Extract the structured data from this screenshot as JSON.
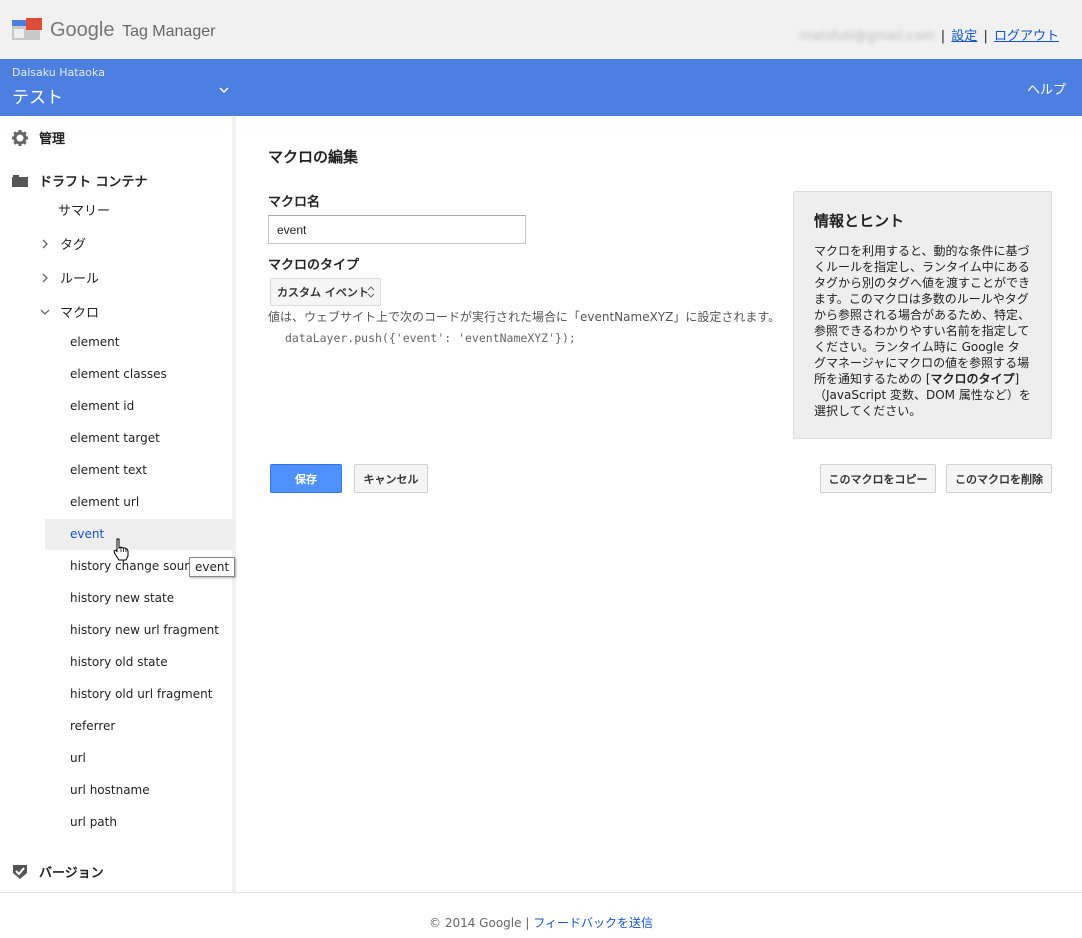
{
  "header": {
    "logo_google": "Google",
    "logo_product": "Tag Manager",
    "account_email": "matsfuti@gmail.com",
    "settings_link": "設定",
    "logout_link": "ログアウト",
    "separator": "|"
  },
  "bluebar": {
    "account_name": "Daisaku Hataoka",
    "container_name": "テスト",
    "help": "ヘルプ"
  },
  "sidebar": {
    "admin": "管理",
    "draft_container": "ドラフト コンテナ",
    "summary": "サマリー",
    "tags": "タグ",
    "rules": "ルール",
    "macros": "マクロ",
    "macro_items": [
      "element",
      "element classes",
      "element id",
      "element target",
      "element text",
      "element url",
      "event",
      "history change source",
      "history new state",
      "history new url fragment",
      "history old state",
      "history old url fragment",
      "referrer",
      "url",
      "url hostname",
      "url path"
    ],
    "active_macro": "event",
    "tooltip": "event",
    "versions": "バージョン"
  },
  "main": {
    "title": "マクロの編集",
    "macro_name_label": "マクロ名",
    "macro_name_value": "event",
    "macro_type_label": "マクロのタイプ",
    "macro_type_value": "カスタム イベント",
    "description": "値は、ウェブサイト上で次のコードが実行された場合に「eventNameXYZ」に設定されます。",
    "code": "dataLayer.push({'event': 'eventNameXYZ'});",
    "save_button": "保存",
    "cancel_button": "キャンセル",
    "copy_button": "このマクロをコピー",
    "delete_button": "このマクロを削除"
  },
  "hints": {
    "title": "情報とヒント",
    "body_part1": "マクロを利用すると、動的な条件に基づくルールを指定し、ランタイム中にあるタグから別のタグへ値を渡すことができます。このマクロは多数のルールやタグから参照される場合があるため、特定、参照できるわかりやすい名前を指定してください。ランタイム時に Google タグマネージャにマクロの値を参照する場所を通知するための [",
    "body_bold": "マクロのタイプ",
    "body_part2": "]（JavaScript 変数、DOM 属性など）を選択してください。"
  },
  "footer": {
    "copyright": "© 2014 Google",
    "separator": "|",
    "feedback_link": "フィードバックを送信"
  },
  "colors": {
    "blue_bar": "#4d7fe0",
    "primary_button": "#4d90fe",
    "link": "#1155cc",
    "header_bg": "#f1f1f1"
  },
  "icons": {
    "logo": "tag-manager-logo-icon",
    "admin": "gear-icon",
    "draft": "folder-icon",
    "versions": "shield-check-icon",
    "chevron": "chevron-down-icon"
  }
}
